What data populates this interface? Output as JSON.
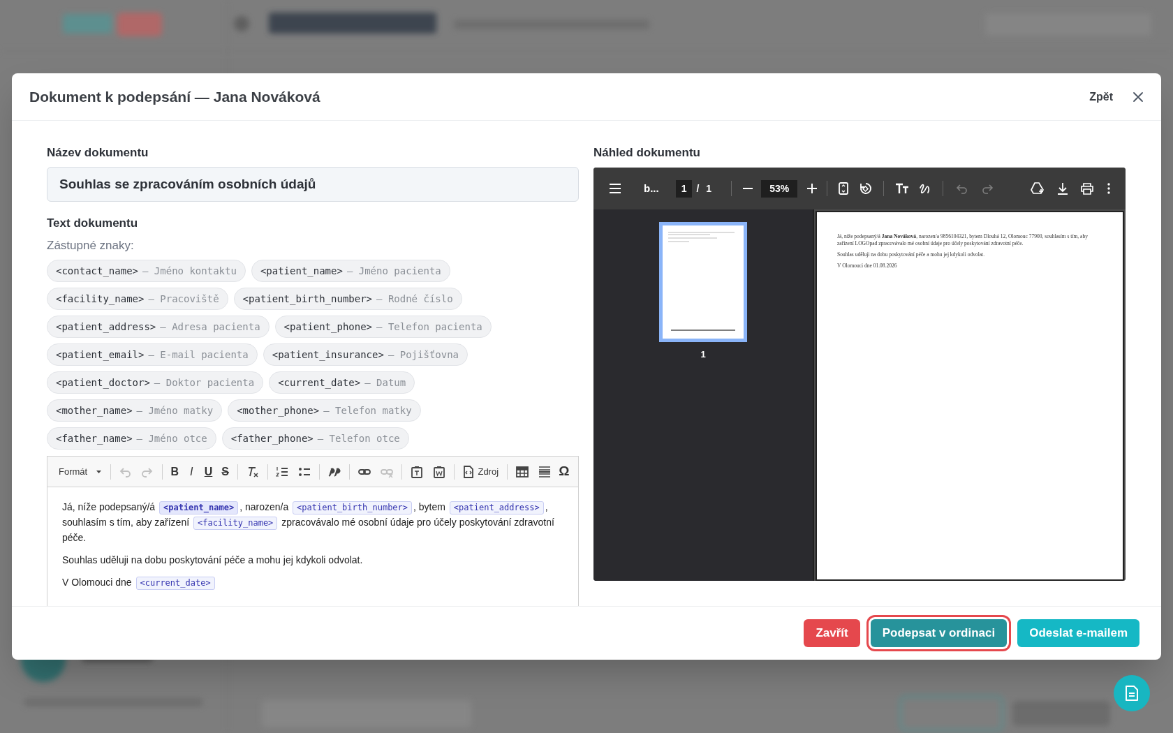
{
  "modal": {
    "title": "Dokument k podepsání — Jana Nováková",
    "back_link": "Zpět"
  },
  "document_name": {
    "label": "Název dokumentu",
    "value": "Souhlas se zpracováním osobních údajů"
  },
  "document_text": {
    "label": "Text dokumentu",
    "placeholders_label": "Zástupné znaky:",
    "placeholders": [
      {
        "code": "<contact_name>",
        "description": "— Jméno kontaktu"
      },
      {
        "code": "<patient_name>",
        "description": "— Jméno pacienta"
      },
      {
        "code": "<facility_name>",
        "description": "— Pracoviště"
      },
      {
        "code": "<patient_birth_number>",
        "description": "— Rodné číslo"
      },
      {
        "code": "<patient_address>",
        "description": "— Adresa pacienta"
      },
      {
        "code": "<patient_phone>",
        "description": "— Telefon pacienta"
      },
      {
        "code": "<patient_email>",
        "description": "— E-mail pacienta"
      },
      {
        "code": "<patient_insurance>",
        "description": "— Pojišťovna"
      },
      {
        "code": "<patient_doctor>",
        "description": "— Doktor pacienta"
      },
      {
        "code": "<current_date>",
        "description": "— Datum"
      },
      {
        "code": "<mother_name>",
        "description": "— Jméno matky"
      },
      {
        "code": "<mother_phone>",
        "description": "— Telefon matky"
      },
      {
        "code": "<father_name>",
        "description": "— Jméno otce"
      },
      {
        "code": "<father_phone>",
        "description": "— Telefon otce"
      }
    ]
  },
  "editor": {
    "toolbar": [
      {
        "kind": "dropdown",
        "label": "Formát"
      },
      {
        "kind": "separator"
      },
      {
        "kind": "undo",
        "disabled": true
      },
      {
        "kind": "redo",
        "disabled": true
      },
      {
        "kind": "separator"
      },
      {
        "kind": "bold",
        "label": "B"
      },
      {
        "kind": "italic",
        "label": "I"
      },
      {
        "kind": "underline",
        "label": "U"
      },
      {
        "kind": "strike",
        "label": "S"
      },
      {
        "kind": "separator"
      },
      {
        "kind": "clear-format"
      },
      {
        "kind": "separator"
      },
      {
        "kind": "numbered-list"
      },
      {
        "kind": "bulleted-list"
      },
      {
        "kind": "separator"
      },
      {
        "kind": "quote"
      },
      {
        "kind": "separator"
      },
      {
        "kind": "link",
        "disabled": false
      },
      {
        "kind": "unlink",
        "disabled": true
      },
      {
        "kind": "separator"
      },
      {
        "kind": "paste-text"
      },
      {
        "kind": "paste-word"
      },
      {
        "kind": "separator"
      },
      {
        "kind": "source",
        "label": "Zdroj"
      },
      {
        "kind": "separator"
      },
      {
        "kind": "table"
      },
      {
        "kind": "horizontal-line"
      },
      {
        "kind": "symbol",
        "label": "Ω"
      }
    ],
    "paragraphs": [
      [
        {
          "kind": "text",
          "text": "Já, níže podepsaný/á "
        },
        {
          "kind": "placeholder",
          "text": "<patient_name>",
          "selected": true
        },
        {
          "kind": "text",
          "text": ", narozen/a "
        },
        {
          "kind": "placeholder",
          "text": "<patient_birth_number>",
          "selected": false
        },
        {
          "kind": "text",
          "text": ", bytem "
        },
        {
          "kind": "placeholder",
          "text": "<patient_address>",
          "selected": false
        },
        {
          "kind": "text",
          "text": ", souhlasím s tím, aby zařízení "
        },
        {
          "kind": "placeholder",
          "text": "<facility_name>",
          "selected": false
        },
        {
          "kind": "text",
          "text": " zpracovávalo mé osobní údaje pro účely poskytování zdravotní péče."
        }
      ],
      [
        {
          "kind": "text",
          "text": "Souhlas uděluji na dobu poskytování péče a mohu jej kdykoli odvolat."
        }
      ],
      [
        {
          "kind": "text",
          "text": "V Olomouci dne "
        },
        {
          "kind": "placeholder",
          "text": "<current_date>",
          "selected": false
        }
      ]
    ]
  },
  "preview": {
    "label": "Náhled dokumentu",
    "viewer": {
      "file_name": "b...",
      "page": "1",
      "page_separator": "/",
      "page_count": "1",
      "zoom": "53%",
      "tools": [
        {
          "kind": "undo",
          "disabled": true
        },
        {
          "kind": "redo",
          "disabled": true
        }
      ],
      "thumbnails": [
        {
          "label": "1",
          "selected": true
        }
      ],
      "page_paragraphs": [
        "Já, níže podepsaný/á **Jana Nováková**, narozen/a 9856104321, bytem Dlouhá 12, Olomouc 77900, souhlasím s tím, aby zařízení LOGOpad zpracovávalo mé osobní údaje pro účely poskytování zdravotní péče.",
        "Souhlas uděluji na dobu poskytování péče a mohu jej kdykoli odvolat.",
        "V Olomouci dne 01.08.2026"
      ]
    }
  },
  "footer_buttons": [
    {
      "label": "Zavřít",
      "kind": "danger",
      "highlighted": false
    },
    {
      "label": "Podepsat v ordinaci",
      "kind": "primary",
      "highlighted": true
    },
    {
      "label": "Odeslat e-mailem",
      "kind": "accent",
      "highlighted": false
    }
  ]
}
